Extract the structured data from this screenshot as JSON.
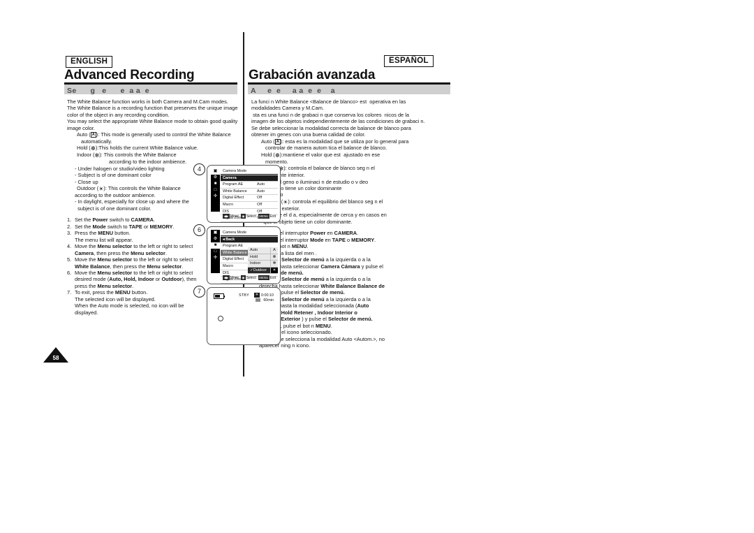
{
  "meta": {
    "page_number": "58",
    "left_language_badge": "ENGLISH",
    "right_language_badge": "ESPAÑOL"
  },
  "english": {
    "chapter_title": "Advanced Recording",
    "section_header": "Se      g   e      e  a a  e",
    "intro": [
      "The White Balance function works in both Camera and M.Cam modes.",
      "The White Balance is a recording function that preserves the unique image",
      "color of the object in any recording condition.",
      "You may select the appropriate White Balance mode to obtain good quality",
      "image color."
    ],
    "modes": {
      "auto_label": "Auto (",
      "auto_icon": "A",
      "auto_text": "): This mode is generally used to control the White Balance",
      "auto_text2": "automatically.",
      "hold_label": "Hold (",
      "hold_icon": "hold-icon",
      "hold_text": "):This holds the current White Balance value.",
      "indoor_label": "Indoor (",
      "indoor_icon": "indoor-icon",
      "indoor_text": "): This controls the White Balance",
      "indoor_text2": "according to the indoor ambience.",
      "indoor_bullets": [
        "- Under halogen or studio/video lighting",
        "- Subject is of one dominant color",
        "- Close up"
      ],
      "outdoor_label": "Outdoor (",
      "outdoor_icon": "outdoor-icon",
      "outdoor_text": "): This controls the White Balance",
      "outdoor_text2": "according to the outdoor ambience.",
      "outdoor_bullets": [
        "- In daylight, especially for close up and where the",
        "  subject is of one dominant color."
      ]
    },
    "steps": [
      {
        "n": "1.",
        "lines": [
          [
            {
              "t": "Set the "
            },
            {
              "t": "Power",
              "b": true
            },
            {
              "t": " switch to "
            },
            {
              "t": "CAMERA",
              "b": true
            },
            {
              "t": "."
            }
          ]
        ]
      },
      {
        "n": "2.",
        "lines": [
          [
            {
              "t": "Set the "
            },
            {
              "t": "Mode",
              "b": true
            },
            {
              "t": " switch to "
            },
            {
              "t": "TAPE",
              "b": true
            },
            {
              "t": " or "
            },
            {
              "t": "MEMORY",
              "b": true
            },
            {
              "t": "."
            }
          ]
        ]
      },
      {
        "n": "3.",
        "lines": [
          [
            {
              "t": "Press the "
            },
            {
              "t": "MENU",
              "b": true
            },
            {
              "t": " button."
            }
          ],
          [
            {
              "t": "    The menu list will appear."
            }
          ]
        ]
      },
      {
        "n": "4.",
        "lines": [
          [
            {
              "t": "Move the "
            },
            {
              "t": "Menu selector",
              "b": true
            },
            {
              "t": " to the left or right to select"
            }
          ],
          [
            {
              "t": "Camera",
              "b": true
            },
            {
              "t": ", then press the "
            },
            {
              "t": "Menu selector",
              "b": true
            },
            {
              "t": "."
            }
          ]
        ]
      },
      {
        "n": "5.",
        "lines": [
          [
            {
              "t": "Move the "
            },
            {
              "t": "Menu selector",
              "b": true
            },
            {
              "t": " to the left or right to select"
            }
          ],
          [
            {
              "t": "White Balance",
              "b": true
            },
            {
              "t": ", then press the "
            },
            {
              "t": "Menu selector",
              "b": true
            },
            {
              "t": "."
            }
          ]
        ]
      },
      {
        "n": "6.",
        "lines": [
          [
            {
              "t": "Move the "
            },
            {
              "t": "Menu selector",
              "b": true
            },
            {
              "t": " to the left or right to select"
            }
          ],
          [
            {
              "t": "desired mode ("
            },
            {
              "t": "Auto, Hold, Indoor",
              "b": true
            },
            {
              "t": " or "
            },
            {
              "t": "Outdoor",
              "b": true
            },
            {
              "t": "), then"
            }
          ],
          [
            {
              "t": "press the "
            },
            {
              "t": "Menu selector",
              "b": true
            },
            {
              "t": "."
            }
          ]
        ]
      },
      {
        "n": "7.",
        "lines": [
          [
            {
              "t": "To exit, press the "
            },
            {
              "t": "MENU",
              "b": true
            },
            {
              "t": " button."
            }
          ],
          [
            {
              "t": "    The selected icon will be displayed."
            }
          ],
          [
            {
              "t": "    When the Auto mode is selected, no icon will be"
            }
          ],
          [
            {
              "t": "    displayed."
            }
          ]
        ]
      }
    ]
  },
  "spanish": {
    "chapter_title": "Grabación avanzada",
    "section_header": "A     e  e     a a  e  e    a",
    "intro": [
      "La funci n White Balance <Balance de blanco> est  operativa en las",
      "modalidades Camera y M.Cam.",
      " sta es una funci n de grabaci n que conserva los colores  nicos de la",
      "imagen de los objetos independientemente de las condiciones de grabaci n.",
      "Se debe seleccionar la modalidad correcta de balance de blanco para",
      "obtener im genes con una buena calidad de color."
    ],
    "modes": {
      "auto_label": "Auto (",
      "auto_icon": "A",
      "auto_text": "): esta es la modalidad que se utiliza por lo general para",
      "auto_text2": "controlar de manera autom tica el balance de blanco.",
      "hold_label": "Hold (",
      "hold_icon": "hold-icon",
      "hold_text": "):mantiene el valor que est  ajustado en ese",
      "hold_text2": "momento.",
      "indoor_label": "Indoor (",
      "indoor_icon": "indoor-icon",
      "indoor_text": "): controla el balance de blanco seg n el",
      "indoor_text2": "ambiente interior.",
      "indoor_bullets": [
        "-  Con hal geno o iluminaci n de estudio o v deo",
        "-  El objeto tiene un color dominante",
        "-  Cercano"
      ],
      "outdoor_label": "Outdoor (",
      "outdoor_icon": "outdoor-icon",
      "outdoor_text": "): controla el equilibrio del blanco seg n el",
      "outdoor_text2": "ambiente exterior.",
      "outdoor_bullets": [
        "-  Durante el d a, especialmente de cerca y en casos en",
        "   que el objeto tiene un color dominante."
      ]
    },
    "steps": [
      {
        "n": "1.",
        "lines": [
          [
            {
              "t": "Coloque el interruptor "
            },
            {
              "t": "Power",
              "b": true
            },
            {
              "t": " en "
            },
            {
              "t": "CAMERA",
              "b": true
            },
            {
              "t": "."
            }
          ]
        ]
      },
      {
        "n": "2.",
        "lines": [
          [
            {
              "t": "Coloque el interruptor "
            },
            {
              "t": "Mode",
              "b": true
            },
            {
              "t": " en "
            },
            {
              "t": "TAPE",
              "b": true
            },
            {
              "t": " o "
            },
            {
              "t": "MEMORY",
              "b": true
            },
            {
              "t": "."
            }
          ]
        ]
      },
      {
        "n": "3.",
        "lines": [
          [
            {
              "t": "Pulse el bot n  "
            },
            {
              "t": "MENU",
              "b": true
            },
            {
              "t": "."
            }
          ],
          [
            {
              "t": "    Aparece la lista del men ."
            }
          ]
        ]
      },
      {
        "n": "4.",
        "lines": [
          [
            {
              "t": "Mueva el "
            },
            {
              "t": "Selector de menú",
              "b": true
            },
            {
              "t": " a la izquierda o a la"
            }
          ],
          [
            {
              "t": "derecha hasta seleccionar "
            },
            {
              "t": "Camera   Cámara",
              "b": true
            },
            {
              "t": "  y pulse el"
            }
          ],
          [
            {
              "t": "Selector de menú.",
              "b": true
            }
          ]
        ]
      },
      {
        "n": "5.",
        "lines": [
          [
            {
              "t": "Mueva el "
            },
            {
              "t": "Selector de menú",
              "b": true
            },
            {
              "t": " a la izquierda o a la"
            }
          ],
          [
            {
              "t": "derecha hasta seleccionar "
            },
            {
              "t": "White Balance   Balance de",
              "b": true
            }
          ],
          [
            {
              "t": "blanco",
              "b": true
            },
            {
              "t": "  y pulse el "
            },
            {
              "t": "Selector de menú.",
              "b": true
            }
          ]
        ]
      },
      {
        "n": "6.",
        "lines": [
          [
            {
              "t": "Mueva el "
            },
            {
              "t": "Selector de menú",
              "b": true
            },
            {
              "t": " a la izquierda o a la"
            }
          ],
          [
            {
              "t": "derecha hasta la modalidad seleccionada ("
            },
            {
              "t": "Auto",
              "b": true
            }
          ],
          [
            {
              "t": "  Autom. , Hold  Retener , Indoor  Interior   o",
              "b": true
            }
          ],
          [
            {
              "t": "Outdoor   Exterior  ",
              "b": true
            },
            {
              "t": ") y pulse el "
            },
            {
              "t": "Selector de menú.",
              "b": true
            }
          ]
        ]
      },
      {
        "n": "7.",
        "lines": [
          [
            {
              "t": "Para salir, pulse el bot n  "
            },
            {
              "t": "MENU",
              "b": true
            },
            {
              "t": "."
            }
          ],
          [
            {
              "t": "    Aparecer  el icono seleccionado."
            }
          ],
          [
            {
              "t": "    Cuando se selecciona la modalidad Auto <Autom.>, no"
            }
          ],
          [
            {
              "t": "    aparecer  ning n icono."
            }
          ]
        ]
      }
    ]
  },
  "illustrations": {
    "step_labels": {
      "first": "4",
      "second": "6",
      "third": "7"
    },
    "lcd_camera_menu": {
      "title": "Camera Mode",
      "selected_row": "Camera",
      "rows": [
        {
          "label": "Program AE",
          "value": "Auto"
        },
        {
          "label": "White Balance",
          "value": "Auto"
        },
        {
          "label": "Digital Effect",
          "value": "Off"
        },
        {
          "label": "Macro",
          "value": "Off"
        },
        {
          "label": "DIS",
          "value": "Off"
        },
        {
          "label": "Digital Zoom",
          "value": "Off"
        }
      ],
      "hints": [
        {
          "chip": "◀▶",
          "text": "Move"
        },
        {
          "chip": "◉",
          "text": "Select"
        },
        {
          "chip": "MENU",
          "text": "Exit"
        }
      ]
    },
    "lcd_wb_submenu": {
      "title": "Camera Mode",
      "back_row": "Back",
      "rows": [
        {
          "label": "Program AE"
        },
        {
          "label": "White Balance"
        },
        {
          "label": "Digital Effect"
        },
        {
          "label": "Macro"
        },
        {
          "label": "DIS"
        },
        {
          "label": "Digital Zoom"
        }
      ],
      "highlight_row": "White Balance",
      "options": [
        {
          "label": "Auto",
          "icon": "A",
          "state": "normal"
        },
        {
          "label": "Hold",
          "icon": "hold-icon",
          "state": "normal"
        },
        {
          "label": "Indoor",
          "icon": "indoor-icon",
          "state": "normal"
        },
        {
          "label": "Outdoor",
          "icon": "outdoor-icon",
          "state": "selected",
          "check": "✓"
        }
      ],
      "hints": [
        {
          "chip": "◀▶",
          "text": "Move"
        },
        {
          "chip": "◉",
          "text": "Select"
        },
        {
          "chip": "MENU",
          "text": "Exit"
        }
      ]
    },
    "lcd_viewfinder": {
      "status": "STBY",
      "timecode": "0:00:10",
      "tape_remaining": "60min",
      "wb_icon": "outdoor-icon"
    }
  }
}
